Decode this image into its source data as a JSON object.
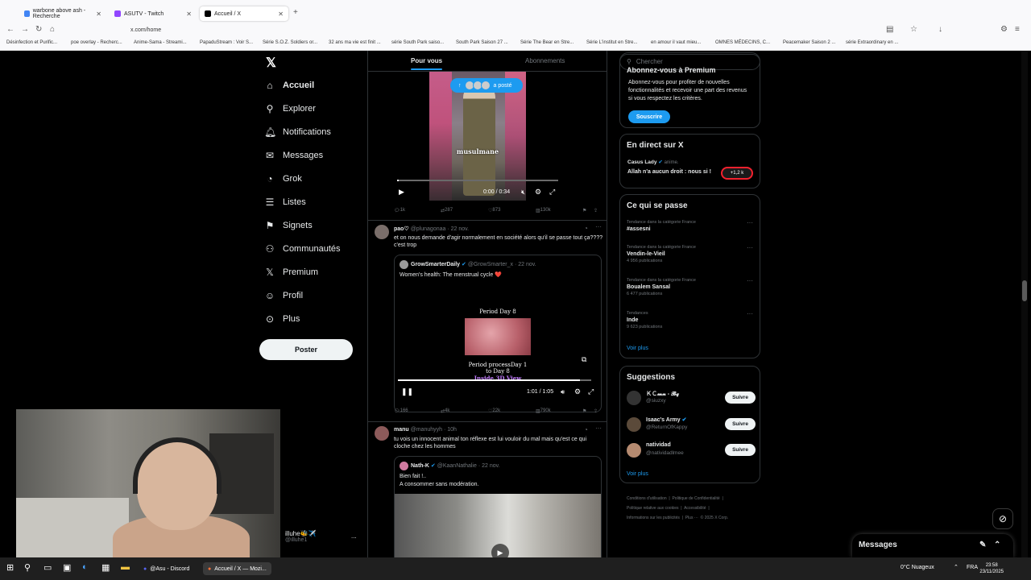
{
  "browser": {
    "tabs": [
      {
        "label": "warbone above ash - Recherche"
      },
      {
        "label": "ASUTV - Twitch"
      },
      {
        "label": "Accueil / X"
      }
    ],
    "new_tab": "+",
    "url": "x.com/home",
    "bookmarks": [
      "Désinfection et Purific...",
      "poe overlay - Recherc...",
      "Anime-Sama - Streami...",
      "PapaduStream : Voir S...",
      "Série S.O.Z. Soldiers or...",
      "32 ans ma vie est finit ...",
      "série South Park saiso...",
      "South Park Saison 27 ...",
      "Série The Bear en Stre...",
      "Série L'institut en Stre...",
      "en amour il vaut mieu...",
      "OMNES MÉDECINS, C...",
      "Peacemaker Saison 2 ...",
      "série Extraordinary en ..."
    ]
  },
  "nav": {
    "items": [
      {
        "label": "Accueil",
        "icon": "home-icon"
      },
      {
        "label": "Explorer",
        "icon": "search-icon"
      },
      {
        "label": "Notifications",
        "icon": "bell-icon"
      },
      {
        "label": "Messages",
        "icon": "mail-icon"
      },
      {
        "label": "Grok",
        "icon": "grok-icon"
      },
      {
        "label": "Listes",
        "icon": "list-icon"
      },
      {
        "label": "Signets",
        "icon": "bookmark-icon"
      },
      {
        "label": "Communautés",
        "icon": "people-icon"
      },
      {
        "label": "Premium",
        "icon": "x-icon"
      },
      {
        "label": "Profil",
        "icon": "person-icon"
      },
      {
        "label": "Plus",
        "icon": "more-circle-icon"
      }
    ],
    "post_button": "Poster",
    "account": {
      "name": "illuhe🐝✈️",
      "handle": "@illuhe1",
      "more": "..."
    }
  },
  "feed": {
    "tabs": [
      "Pour vous",
      "Abonnements"
    ],
    "video1": {
      "caption": "musulmane",
      "posted_label": "a posté",
      "time": "0:00 / 0:34"
    },
    "actions1": {
      "replies": "1k",
      "reposts": "287",
      "likes": "873",
      "views": "130k"
    },
    "tweet2": {
      "name": "pao♡",
      "handle": "@plunagonaa",
      "date": "· 22 nov.",
      "text": "et on nous demande d'agir normalement en société alors qu'il se passe tout ça???? c'est trop",
      "quote": {
        "name": "GrowSmarterDaily",
        "handle": "@GrowSmarter_x",
        "date": "· 22 nov.",
        "text": "Women's health: The menstrual cycle ❤️",
        "video_title": "Period Day 8",
        "video_caption1": "Period processDay 1",
        "video_caption2": "to Day 8",
        "video_caption3": "Inside 3D View",
        "time": "1:01 / 1:05",
        "progress": 0.94
      },
      "actions": {
        "replies": "166",
        "reposts": "4k",
        "likes": "22k",
        "views": "790k"
      }
    },
    "tweet3": {
      "name": "manu",
      "handle": "@manuhyyh",
      "date": "· 10h",
      "text": "tu vois un innocent animal ton réflexe est lui vouloir du mal mais qu'est ce qui cloche chez les hommes",
      "quote": {
        "name": "Nath-K",
        "handle": "@KaanNathalie",
        "date": "· 22 nov.",
        "text1": "Bien fait !..",
        "text2": "A consommer sans modération."
      }
    }
  },
  "right": {
    "search_placeholder": "Chercher",
    "premium": {
      "title": "Abonnez-vous à Premium",
      "text": "Abonnez-vous pour profiter de nouvelles fonctionnalités et recevoir une part des revenus si vous respectez les critères.",
      "button": "Souscrire"
    },
    "live": {
      "title": "En direct sur X",
      "host": "Casus Lady",
      "host_meta": "anime.",
      "text": "Allah n'a aucun droit : nous si !",
      "count": "+1,2 k"
    },
    "trends": {
      "title": "Ce qui se passe",
      "items": [
        {
          "category": "Tendance dans la catégorie France",
          "name": "#assesni",
          "count": ""
        },
        {
          "category": "Tendance dans la catégorie France",
          "name": "Vendin-le-Vieil",
          "count": "4 956 publications"
        },
        {
          "category": "Tendance dans la catégorie France",
          "name": "Boualem Sansal",
          "count": "6 477 publications"
        },
        {
          "category": "Tendances",
          "name": "Inde",
          "count": "9 623 publications"
        }
      ],
      "more": "Voir plus"
    },
    "suggestions": {
      "title": "Suggestions",
      "items": [
        {
          "name": "ＫＣ𝓶𝓷 - 𝓑𝓺",
          "handle": "@siuzxy",
          "button": "Suivre"
        },
        {
          "name": "Isaac's Army",
          "handle": "@ReturnOfKappy",
          "button": "Suivre"
        },
        {
          "name": "natividad",
          "handle": "@natividadlmee",
          "button": "Suivre"
        }
      ],
      "more": "Voir plus"
    },
    "footer": [
      "Conditions d'utilisation",
      "Politique de Confidentialité",
      "Politique relative aux cookies",
      "Accessibilité",
      "Informations sur les publicités",
      "Plus ···",
      "© 2025 X Corp."
    ],
    "messages_dock": "Messages"
  },
  "taskbar": {
    "apps": [
      "@Asu - Discord",
      "Accueil / X — Mozi..."
    ],
    "weather": "0°C  Nuageux",
    "lang": "FRA",
    "time": "23:58",
    "date": "23/11/2025"
  }
}
